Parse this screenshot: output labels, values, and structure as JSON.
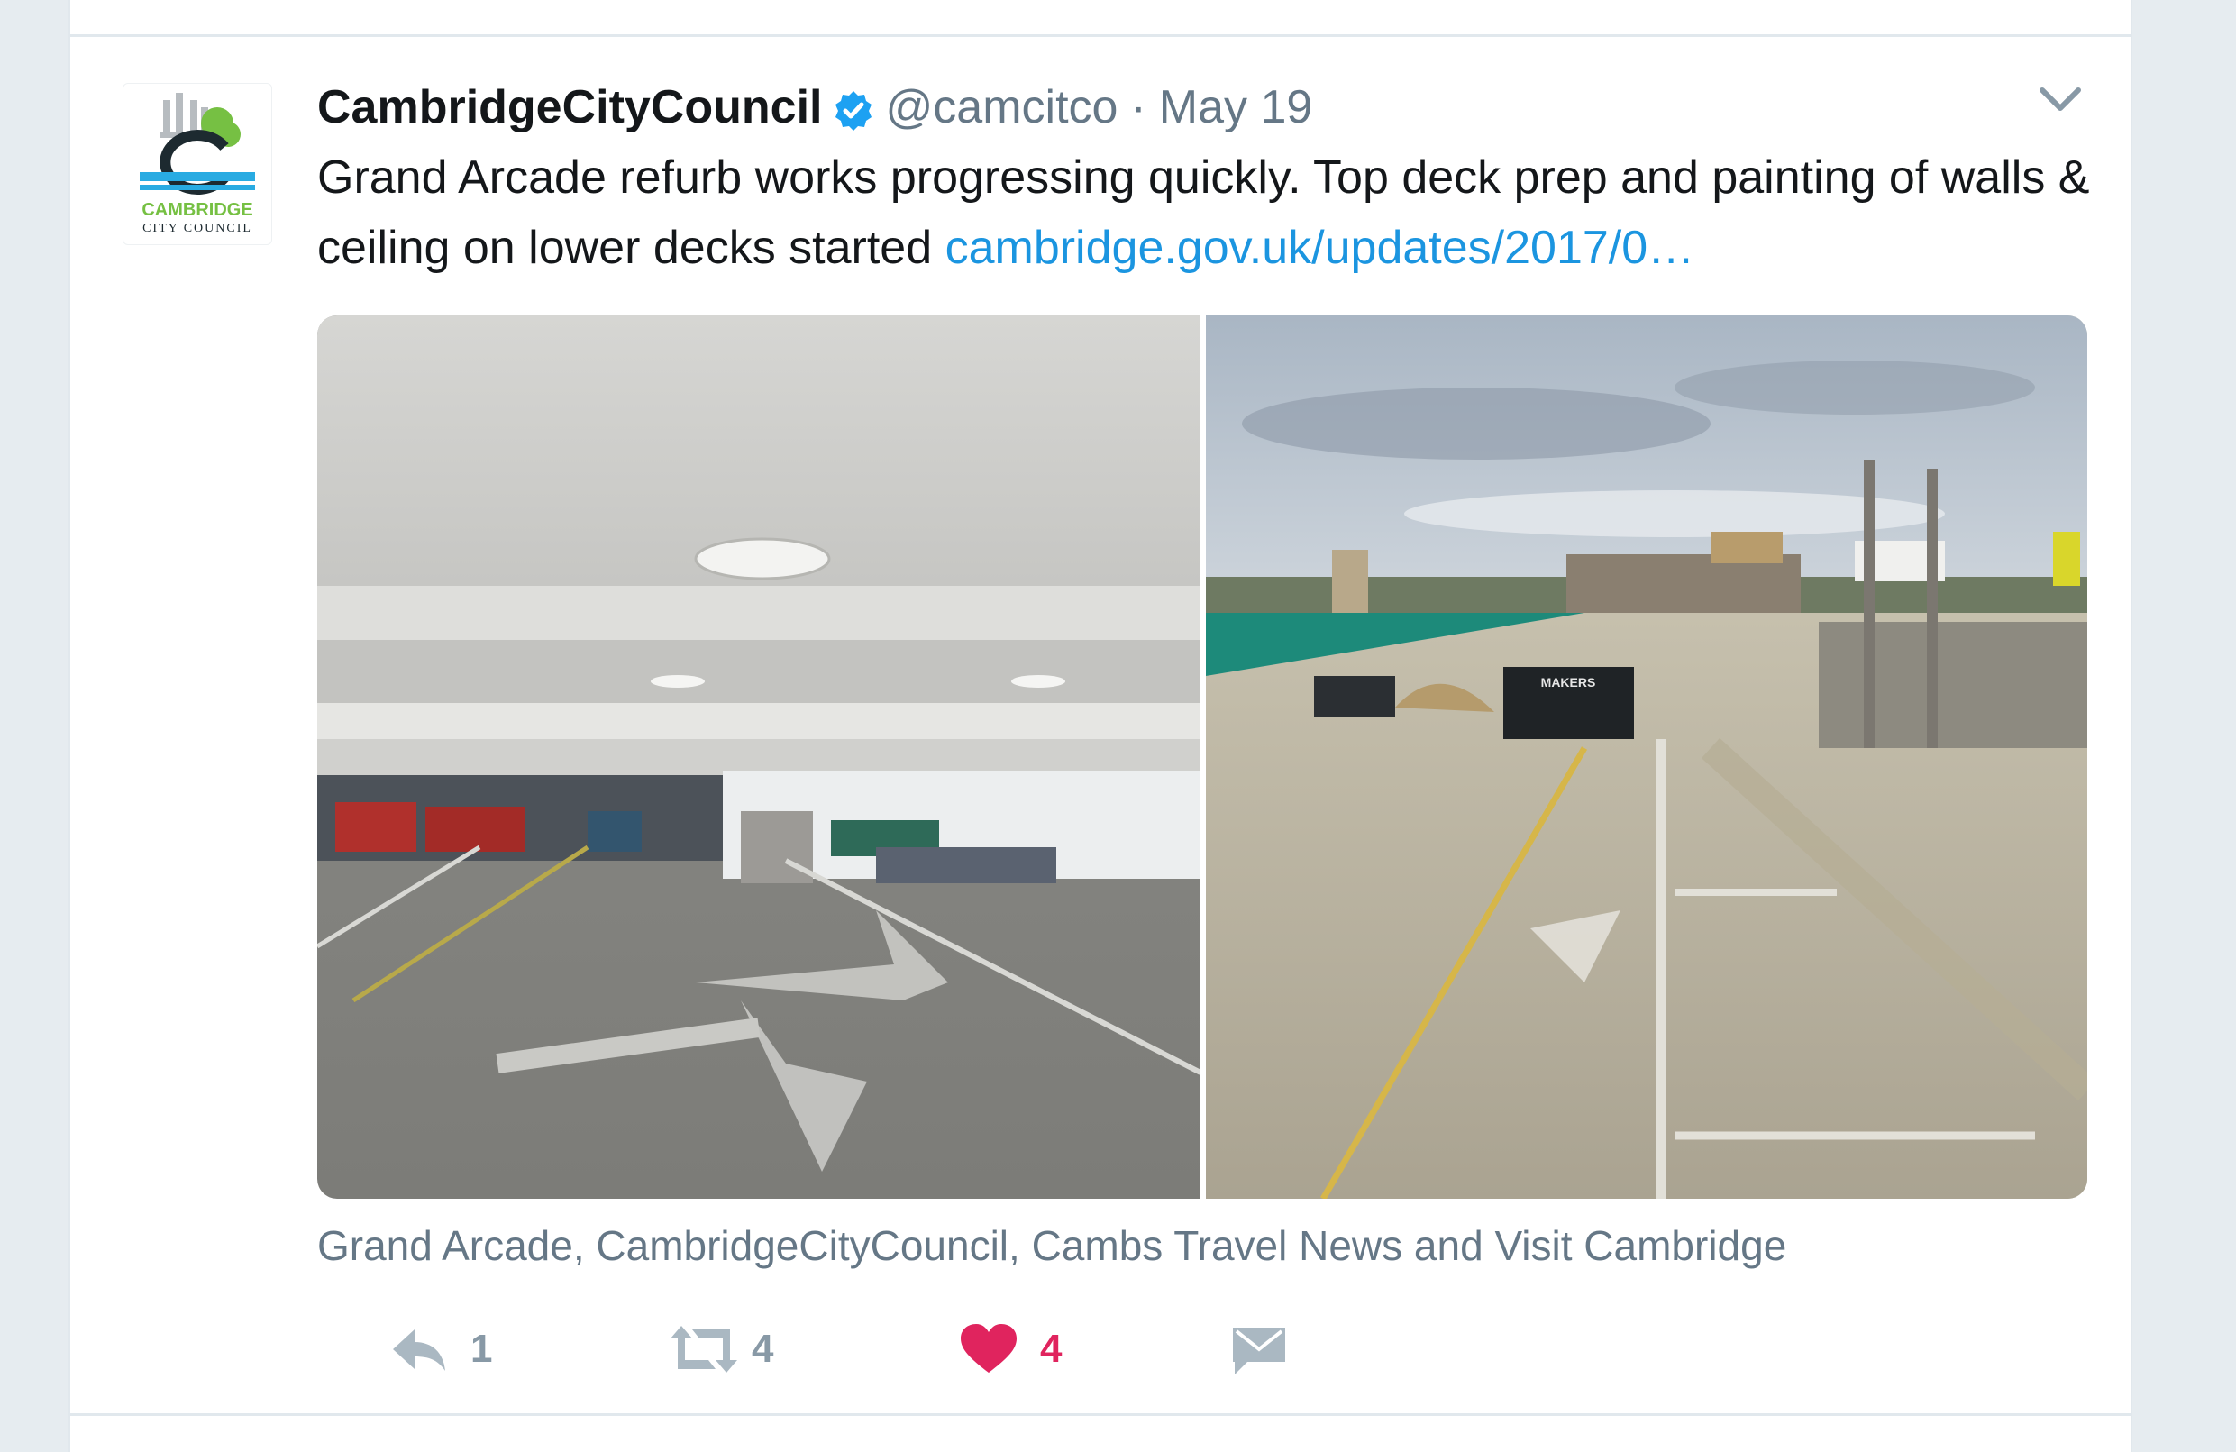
{
  "tweet": {
    "display_name": "CambridgeCityCouncil",
    "handle": "@camcitco",
    "separator": "·",
    "date": "May 19",
    "text": "Grand Arcade refurb works progressing quickly. Top deck prep and painting of walls & ceiling on lower decks started ",
    "link_text": "cambridge.gov.uk/updates/2017/0…",
    "tagged_people": "Grand Arcade, CambridgeCityCouncil, Cambs Travel News and Visit Cambridge"
  },
  "avatar": {
    "logo_line1": "CAMBRIDGE",
    "logo_line2": "CITY COUNCIL"
  },
  "photos": {
    "right_skip_label": "MAKERS"
  },
  "actions": {
    "reply_count": "1",
    "retweet_count": "4",
    "like_count": "4"
  },
  "colors": {
    "link": "#1b95e0",
    "like": "#e0245e",
    "muted": "#657786",
    "verified": "#1da1f2"
  },
  "icons": [
    "verified-badge-icon",
    "caret-down-icon",
    "reply-icon",
    "retweet-icon",
    "heart-icon",
    "envelope-icon"
  ]
}
